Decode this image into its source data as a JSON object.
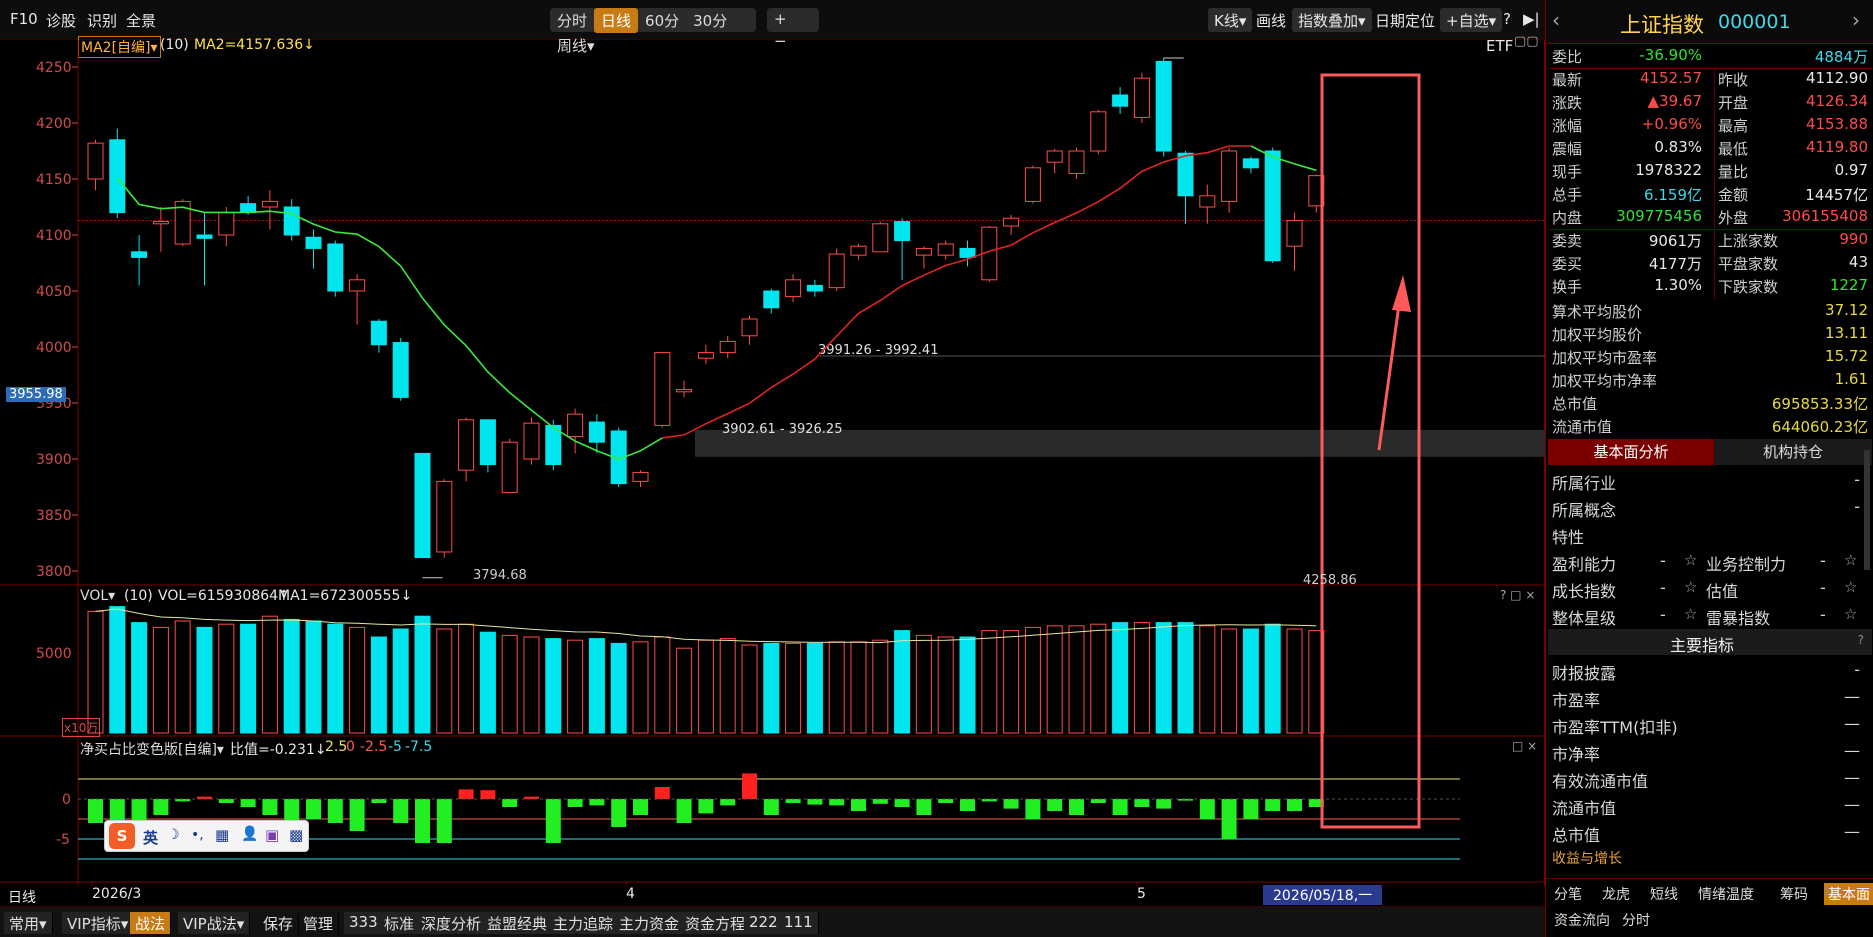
{
  "toolbar": {
    "left": [
      "F10",
      "诊股",
      "识别",
      "全景"
    ],
    "periods": [
      "分时",
      "日线",
      "60分",
      "30分",
      "周线▾"
    ],
    "active_period": "日线",
    "zoom": [
      "+",
      "−"
    ],
    "kline_btn": "K线▾",
    "draw_btn": "画线",
    "overlay_btn": "指数叠加▾",
    "date_locate": "日期定位",
    "add_watch": "+自选▾",
    "help": "?",
    "collapse": "▶|"
  },
  "main_chart": {
    "indicator_label": "MA2[自编]▾",
    "param": "(10)",
    "ma_text": "MA2=4157.636↓",
    "etf_label": "ETF",
    "current_price_tag": "3955.98",
    "y_ticks": [
      "4250",
      "4200",
      "4150",
      "4100",
      "4050",
      "4000",
      "3950",
      "3900",
      "3850",
      "3800"
    ],
    "annotations": {
      "high": "4258.86",
      "low": "3794.68",
      "gap1": "3991.26 - 3992.41",
      "gap2": "3902.61 - 3926.25"
    }
  },
  "volume_panel": {
    "label": "VOL▾",
    "param": "(10)",
    "vol_text": "VOL=615930864↑",
    "ma_text": "MA1=672300555↓",
    "y_tick": "5000",
    "unit": "x10万",
    "controls": "? □ ×"
  },
  "netbuy_panel": {
    "label": "净买占比变色版[自编]▾",
    "ratio_text": "比值=-0.231↓",
    "lines_text_1": "2.5",
    "lines_text_2": "0",
    "lines_text_3": "-2.5",
    "lines_text_4": "-5",
    "lines_text_5": "-7.5",
    "y_ticks": [
      "0",
      "-5"
    ],
    "controls": "□ ×"
  },
  "date_axis": {
    "period": "日线",
    "labels": [
      "2026/3",
      "4",
      "5"
    ],
    "cursor_date": "2026/05/18,一"
  },
  "ime_bar": {
    "items": [
      "S",
      "英",
      "☽",
      "•,",
      "▦",
      "👤",
      "▣",
      "▩"
    ]
  },
  "bottom_tabs": [
    "常用▾",
    "VIP指标▾",
    "战法",
    "VIP战法▾",
    "保存",
    "管理",
    "333",
    "标准",
    "深度分析",
    "益盟经典",
    "主力追踪",
    "主力资金",
    "资金方程",
    "222",
    "111"
  ],
  "bottom_active": "战法",
  "sidebar": {
    "name": "上证指数",
    "code": "000001",
    "rows": [
      {
        "l": "委比",
        "v": "-36.90%",
        "vc": "green",
        "l2": "",
        "v2": "4884万",
        "v2c": "cyan"
      },
      {
        "l": "最新",
        "v": "4152.57",
        "vc": "red",
        "l2": "昨收",
        "v2": "4112.90",
        "v2c": "white"
      },
      {
        "l": "涨跌",
        "v": "▲39.67",
        "vc": "red",
        "l2": "开盘",
        "v2": "4126.34",
        "v2c": "red"
      },
      {
        "l": "涨幅",
        "v": "+0.96%",
        "vc": "red",
        "l2": "最高",
        "v2": "4153.88",
        "v2c": "red"
      },
      {
        "l": "震幅",
        "v": "0.83%",
        "vc": "white",
        "l2": "最低",
        "v2": "4119.80",
        "v2c": "red"
      },
      {
        "l": "现手",
        "v": "1978322",
        "vc": "white",
        "l2": "量比",
        "v2": "0.97",
        "v2c": "white"
      },
      {
        "l": "总手",
        "v": "6.159亿",
        "vc": "cyan",
        "l2": "金额",
        "v2": "14457亿",
        "v2c": "white"
      },
      {
        "l": "内盘",
        "v": "309775456",
        "vc": "green",
        "l2": "外盘",
        "v2": "306155408",
        "v2c": "red"
      },
      {
        "l": "委卖",
        "v": "9061万",
        "vc": "white",
        "l2": "上涨家数",
        "v2": "990",
        "v2c": "red"
      },
      {
        "l": "委买",
        "v": "4177万",
        "vc": "white",
        "l2": "平盘家数",
        "v2": "43",
        "v2c": "white"
      },
      {
        "l": "换手",
        "v": "1.30%",
        "vc": "white",
        "l2": "下跌家数",
        "v2": "1227",
        "v2c": "green"
      }
    ],
    "stats": [
      {
        "l": "算术平均股价",
        "v": "37.12"
      },
      {
        "l": "加权平均股价",
        "v": "13.11"
      },
      {
        "l": "加权平均市盈率",
        "v": "15.72"
      },
      {
        "l": "加权平均市净率",
        "v": "1.61"
      },
      {
        "l": "总市值",
        "v": "695853.33亿"
      },
      {
        "l": "流通市值",
        "v": "644060.23亿"
      }
    ],
    "tabs": [
      "基本面分析",
      "机构持仓"
    ],
    "fund_rows": [
      {
        "l": "所属行业",
        "v": "-"
      },
      {
        "l": "所属概念",
        "v": "-"
      },
      {
        "l": "特性",
        "v": ""
      }
    ],
    "ratings": [
      {
        "l": "盈利能力",
        "v": "-",
        "l2": "业务控制力",
        "v2": "-"
      },
      {
        "l": "成长指数",
        "v": "-",
        "l2": "估值",
        "v2": "-"
      },
      {
        "l": "整体星级",
        "v": "-",
        "l2": "雷暴指数",
        "v2": "-"
      }
    ],
    "main_indicators_title": "主要指标",
    "indicators": [
      {
        "l": "财报披露",
        "v": "-"
      },
      {
        "l": "市盈率",
        "v": "—"
      },
      {
        "l": "市盈率TTM(扣非)",
        "v": "—"
      },
      {
        "l": "市净率",
        "v": "—"
      },
      {
        "l": "有效流通市值",
        "v": "—"
      },
      {
        "l": "流通市值",
        "v": "—"
      },
      {
        "l": "总市值",
        "v": "—"
      }
    ],
    "income_label": "收益与增长",
    "bottom_tabs_row1": [
      "分笔",
      "龙虎",
      "短线",
      "情绪温度",
      "筹码",
      "基本面"
    ],
    "bottom_active": "基本面",
    "bottom_tabs_row2": [
      "资金流向",
      "分时"
    ]
  },
  "colors": {
    "up": "#ff4b4b",
    "down": "#00e5ee",
    "ma": "#e02424",
    "ma_green": "#3be83b",
    "accent": "#c87a14",
    "highlight_box": "#ff5a5a"
  }
}
